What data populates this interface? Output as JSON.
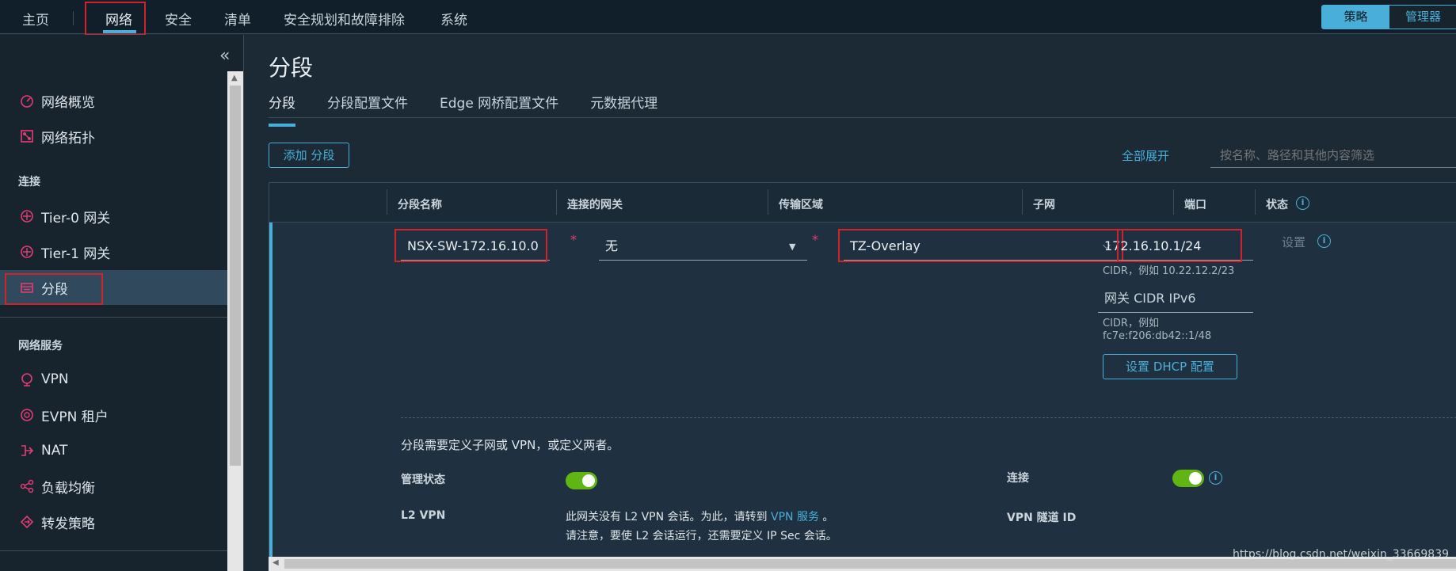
{
  "topnav": {
    "items": [
      "主页",
      "网络",
      "安全",
      "清单",
      "安全规划和故障排除",
      "系统"
    ],
    "mode": {
      "policy": "策略",
      "manager": "管理器"
    }
  },
  "sidebar": {
    "collapse_icon": "double-chevron-left-icon",
    "items_top": [
      {
        "label": "网络概览",
        "icon": "dashboard-icon"
      },
      {
        "label": "网络拓扑",
        "icon": "topology-icon"
      }
    ],
    "section_connect": "连接",
    "items_connect": [
      {
        "label": "Tier-0 网关",
        "icon": "gateway-icon"
      },
      {
        "label": "Tier-1 网关",
        "icon": "gateway-icon"
      },
      {
        "label": "分段",
        "icon": "segment-icon"
      }
    ],
    "section_services": "网络服务",
    "items_services": [
      {
        "label": "VPN",
        "icon": "vpn-icon"
      },
      {
        "label": "EVPN 租户",
        "icon": "evpn-icon"
      },
      {
        "label": "NAT",
        "icon": "nat-icon"
      },
      {
        "label": "负载均衡",
        "icon": "load-balancer-icon"
      },
      {
        "label": "转发策略",
        "icon": "forwarding-policy-icon"
      }
    ]
  },
  "main": {
    "title": "分段",
    "tabs": [
      "分段",
      "分段配置文件",
      "Edge 网桥配置文件",
      "元数据代理"
    ],
    "add_button": "添加 分段",
    "expand_all": "全部展开",
    "filter_placeholder": "按名称、路径和其他内容筛选"
  },
  "grid": {
    "columns": [
      "分段名称",
      "连接的网关",
      "传输区域",
      "子网",
      "端口",
      "状态"
    ],
    "row": {
      "segment_name": "NSX-SW-172.16.10.0",
      "gateway": "无",
      "transport_zone": "TZ-Overlay",
      "subnet": "172.16.10.1/24",
      "subnet_hint": "CIDR，例如 10.22.12.2/23",
      "ipv6_placeholder": "网关 CIDR IPv6",
      "ipv6_hint_1": "CIDR，例如",
      "ipv6_hint_2": "fc7e:f206:db42::1/48",
      "dhcp_button": "设置 DHCP 配置",
      "ports": "设置",
      "notice": "分段需要定义子网或 VPN，或定义两者。",
      "admin_state_label": "管理状态",
      "admin_state_on": true,
      "connection_label": "连接",
      "connection_on": true,
      "l2vpn_label": "L2 VPN",
      "l2vpn_text_1": "此网关没有 L2 VPN 会话。为此，请转到",
      "l2vpn_link": "VPN 服务",
      "l2vpn_text_1_end": "。",
      "l2vpn_text_2": "请注意，要使 L2 会话运行，还需要定义 IP Sec 会话。",
      "vpn_tunnel_label": "VPN 隧道 ID"
    }
  },
  "watermark": "https://blog.csdn.net/weixin_33669839",
  "colors": {
    "accent": "#49afd9",
    "highlight_box": "#d0222a",
    "toggle_on": "#60b515",
    "icon_pink": "#e23d73"
  }
}
